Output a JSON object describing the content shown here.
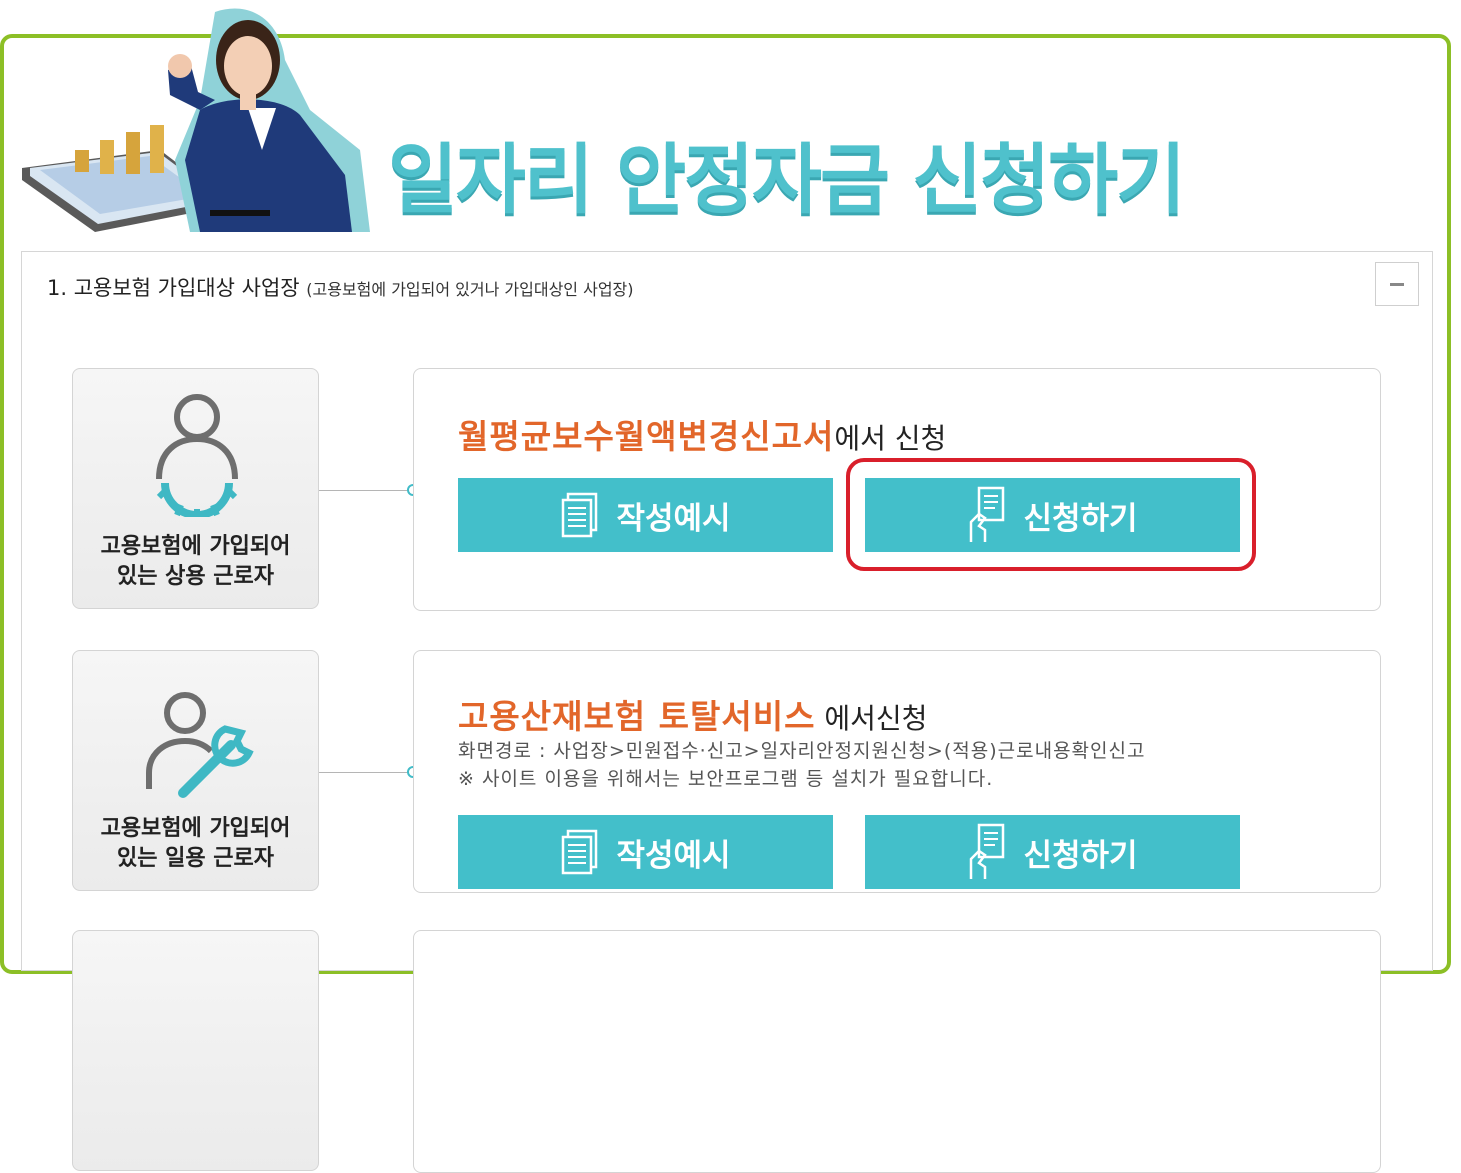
{
  "header": {
    "title": "일자리 안정자금 신청하기"
  },
  "section": {
    "heading": "1. 고용보험 가입대상 사업장",
    "subheading": "(고용보험에 가입되어 있거나 가입대상인 사업장)"
  },
  "rows": [
    {
      "category_line1": "고용보험에 가입되어",
      "category_line2": "있는 상용 근로자",
      "category_icon": "person-gear-icon",
      "title": "월평균보수월액변경신고서",
      "title_suffix": "에서 신청",
      "example_label": "작성예시",
      "apply_label": "신청하기"
    },
    {
      "category_line1": "고용보험에 가입되어",
      "category_line2": "있는 일용 근로자",
      "category_icon": "person-wrench-icon",
      "title": "고용산재보험 토탈서비스",
      "title_suffix": " 에서신청",
      "desc_line1": "화면경로 : 사업장>민원접수·신고>일자리안정지원신청>(적용)근로내용확인신고",
      "desc_line2": "※ 사이트 이용을 위해서는 보안프로그램 등 설치가 필요합니다.",
      "example_label": "작성예시",
      "apply_label": "신청하기"
    }
  ],
  "colors": {
    "frame_green": "#8cbf26",
    "accent_teal": "#43bfca",
    "title_orange": "#e2662a",
    "highlight_red": "#d91f2b"
  }
}
